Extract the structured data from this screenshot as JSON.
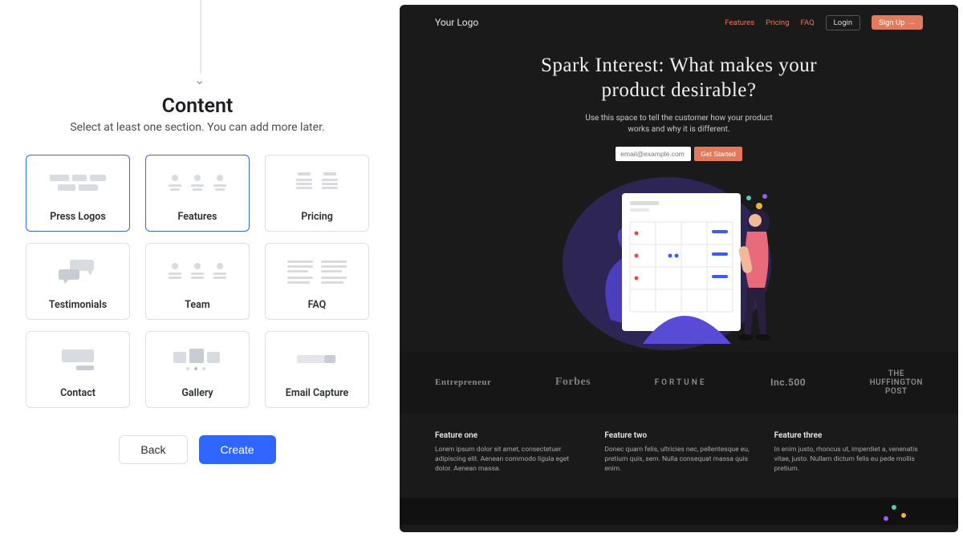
{
  "left": {
    "title": "Content",
    "subtitle": "Select at least one section. You can add more later.",
    "cards": [
      {
        "label": "Press Logos",
        "selected": true
      },
      {
        "label": "Features",
        "selected": true
      },
      {
        "label": "Pricing",
        "selected": false
      },
      {
        "label": "Testimonials",
        "selected": false
      },
      {
        "label": "Team",
        "selected": false
      },
      {
        "label": "FAQ",
        "selected": false
      },
      {
        "label": "Contact",
        "selected": false
      },
      {
        "label": "Gallery",
        "selected": false
      },
      {
        "label": "Email Capture",
        "selected": false
      }
    ],
    "back": "Back",
    "create": "Create"
  },
  "preview": {
    "logo": "Your Logo",
    "nav": {
      "features": "Features",
      "pricing": "Pricing",
      "faq": "FAQ",
      "login": "Login",
      "signup": "Sign Up"
    },
    "hero": {
      "title": "Spark Interest: What makes your product desirable?",
      "sub": "Use this space to tell the customer how your product works and why it is different.",
      "placeholder": "email@example.com",
      "cta": "Get Started"
    },
    "press": {
      "p1": "Entrepreneur",
      "p2": "Forbes",
      "p3": "FORTUNE",
      "p4": "Inc.500",
      "p5a": "THE",
      "p5b": "HUFFINGTON",
      "p5c": "POST"
    },
    "features": [
      {
        "h": "Feature one",
        "b": "Lorem ipsum dolor sit amet, consectetuer adipiscing elit. Aenean commodo ligula eget dolor. Aenean massa."
      },
      {
        "h": "Feature two",
        "b": "Donec quam felis, ultricies nec, pellentesque eu, pretium quis, sem. Nulla consequat massa quis enim."
      },
      {
        "h": "Feature three",
        "b": "In enim justo, rhoncus ut, imperdiet a, venenatis vitae, justo. Nullam dictum felis eu pede mollis pretium."
      }
    ]
  }
}
